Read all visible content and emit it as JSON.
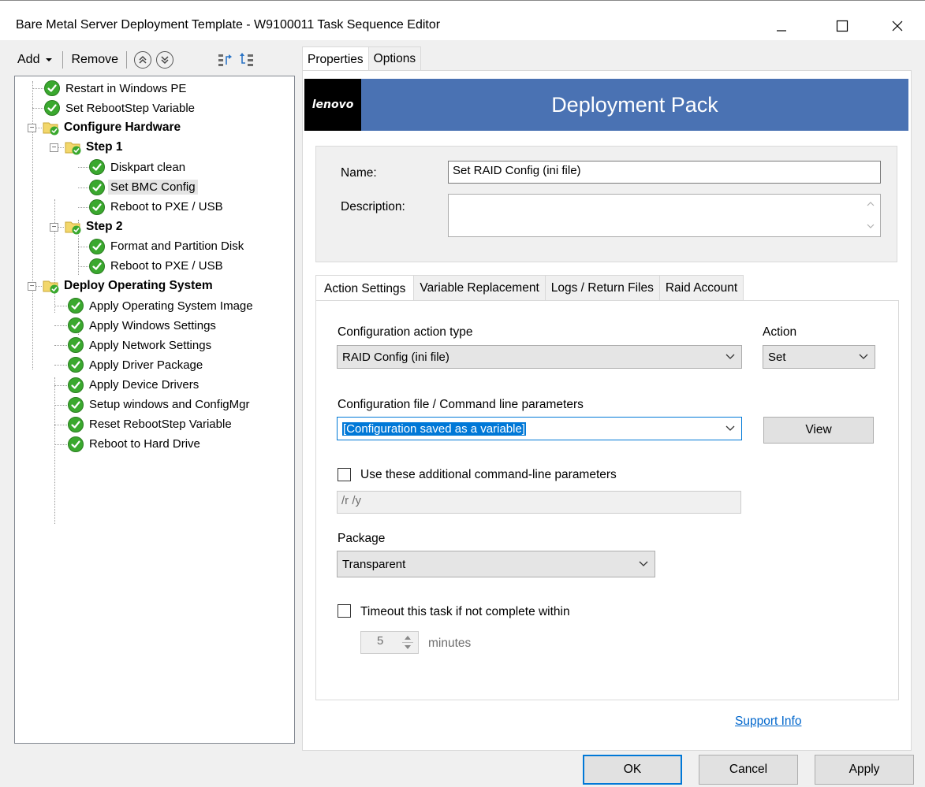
{
  "window": {
    "title": "Bare Metal Server Deployment Template - W9100011 Task Sequence Editor"
  },
  "toolbar": {
    "add_label": "Add",
    "remove_label": "Remove"
  },
  "tree": [
    {
      "label": "Restart in Windows PE",
      "type": "step",
      "level": 1
    },
    {
      "label": "Set RebootStep Variable",
      "type": "step",
      "level": 1
    },
    {
      "label": "Configure Hardware",
      "type": "group",
      "level": 0
    },
    {
      "label": "Step 1",
      "type": "group",
      "level": 1
    },
    {
      "label": "Diskpart clean",
      "type": "step",
      "level": 2
    },
    {
      "label": "Set BMC Config",
      "type": "step",
      "level": 2,
      "selected": true
    },
    {
      "label": "Reboot to PXE / USB",
      "type": "step",
      "level": 2
    },
    {
      "label": "Step 2",
      "type": "group",
      "level": 1
    },
    {
      "label": "Format and Partition Disk",
      "type": "step",
      "level": 2
    },
    {
      "label": "Reboot to PXE / USB",
      "type": "step",
      "level": 2
    },
    {
      "label": "Deploy Operating System",
      "type": "group",
      "level": 0
    },
    {
      "label": "Apply Operating System Image",
      "type": "step",
      "level": 1
    },
    {
      "label": "Apply Windows Settings",
      "type": "step",
      "level": 1
    },
    {
      "label": "Apply Network Settings",
      "type": "step",
      "level": 1
    },
    {
      "label": "Apply Driver Package",
      "type": "step",
      "level": 1
    },
    {
      "label": "Apply Device Drivers",
      "type": "step",
      "level": 1
    },
    {
      "label": "Setup windows and ConfigMgr",
      "type": "step",
      "level": 1
    },
    {
      "label": "Reset RebootStep Variable",
      "type": "step",
      "level": 1
    },
    {
      "label": "Reboot to Hard Drive",
      "type": "step",
      "level": 1
    }
  ],
  "tabs": [
    "Properties",
    "Options"
  ],
  "banner": {
    "logo": "lenovo",
    "title": "Deployment Pack"
  },
  "form": {
    "name_label": "Name:",
    "name_value": "Set RAID Config (ini file)",
    "description_label": "Description:",
    "description_value": ""
  },
  "inner_tabs": [
    "Action Settings",
    "Variable Replacement",
    "Logs / Return Files",
    "Raid Account"
  ],
  "action_settings": {
    "config_action_type_label": "Configuration action type",
    "config_action_type_value": "RAID Config (ini file)",
    "action_label": "Action",
    "action_value": "Set",
    "config_file_label": "Configuration file / Command line parameters",
    "config_file_value": "[Configuration saved as a variable]",
    "view_button": "View",
    "additional_params_label": "Use these additional command-line parameters",
    "additional_params_value": "/r /y",
    "package_label": "Package",
    "package_value": "Transparent",
    "timeout_label": "Timeout this task if not complete within",
    "timeout_value": "5",
    "timeout_unit": "minutes"
  },
  "support_link": "Support Info",
  "buttons": {
    "ok": "OK",
    "cancel": "Cancel",
    "apply": "Apply"
  },
  "colors": {
    "banner": "#4a72b3",
    "accent": "#0078d7",
    "check_green": "#3aa82e",
    "folder_yellow": "#f2d76b"
  }
}
